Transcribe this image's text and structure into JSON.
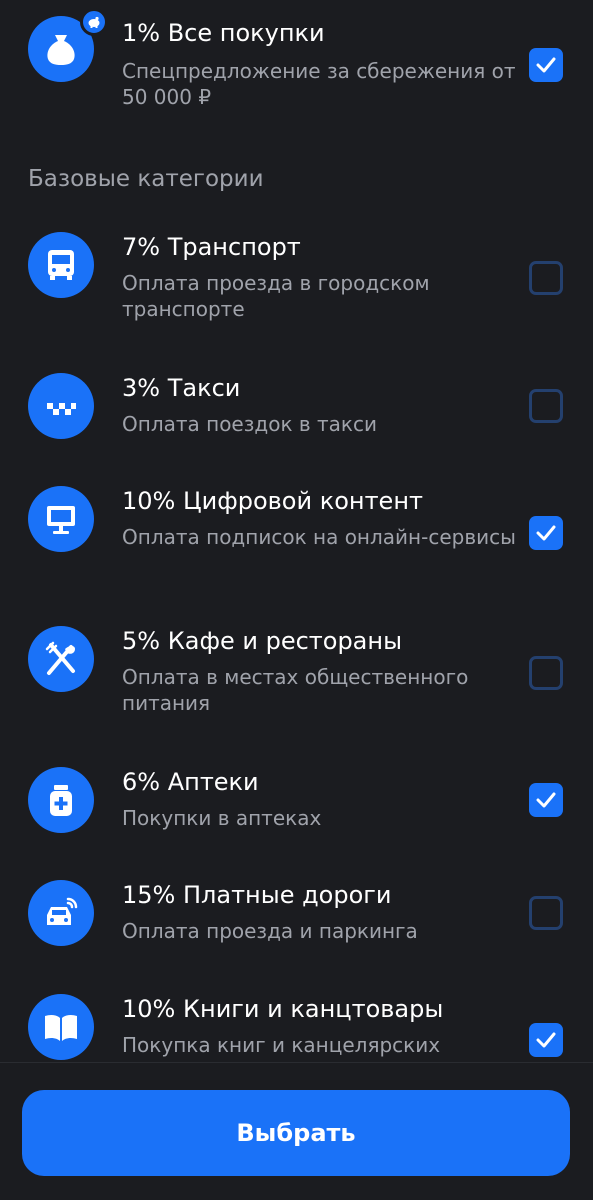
{
  "colors": {
    "background": "#1b1c20",
    "accent": "#1a72f8",
    "text_primary": "#ffffff",
    "text_secondary": "#a0a3ab",
    "checkbox_off_border": "#24406e"
  },
  "top_item": {
    "title": "1% Все покупки",
    "subtitle": "Спецпредложение за сбережения от 50 000 ₽",
    "icon": "money-bag-icon",
    "badge_icon": "piggy-bank-icon",
    "checked": true
  },
  "section": {
    "header": "Базовые категории"
  },
  "categories": [
    {
      "title": "7% Транспорт",
      "subtitle": "Оплата проезда в городском транспорте",
      "icon": "bus-icon",
      "checked": false
    },
    {
      "title": "3% Такси",
      "subtitle": "Оплата поездок в такси",
      "icon": "taxi-icon",
      "checked": false
    },
    {
      "title": "10% Цифровой контент",
      "subtitle": "Оплата подписок на онлайн-сервисы",
      "icon": "monitor-icon",
      "checked": true
    },
    {
      "title": "5% Кафе и рестораны",
      "subtitle": "Оплата в местах общественного питания",
      "icon": "fork-knife-icon",
      "checked": false
    },
    {
      "title": "6% Аптеки",
      "subtitle": "Покупки в аптеках",
      "icon": "pharmacy-icon",
      "checked": true
    },
    {
      "title": "15% Платные дороги",
      "subtitle": "Оплата проезда и паркинга",
      "icon": "connected-car-icon",
      "checked": false
    },
    {
      "title": "10% Книги и канцтовары",
      "subtitle": "Покупка книг и канцелярских",
      "icon": "book-icon",
      "checked": true
    }
  ],
  "footer": {
    "select_label": "Выбрать"
  }
}
